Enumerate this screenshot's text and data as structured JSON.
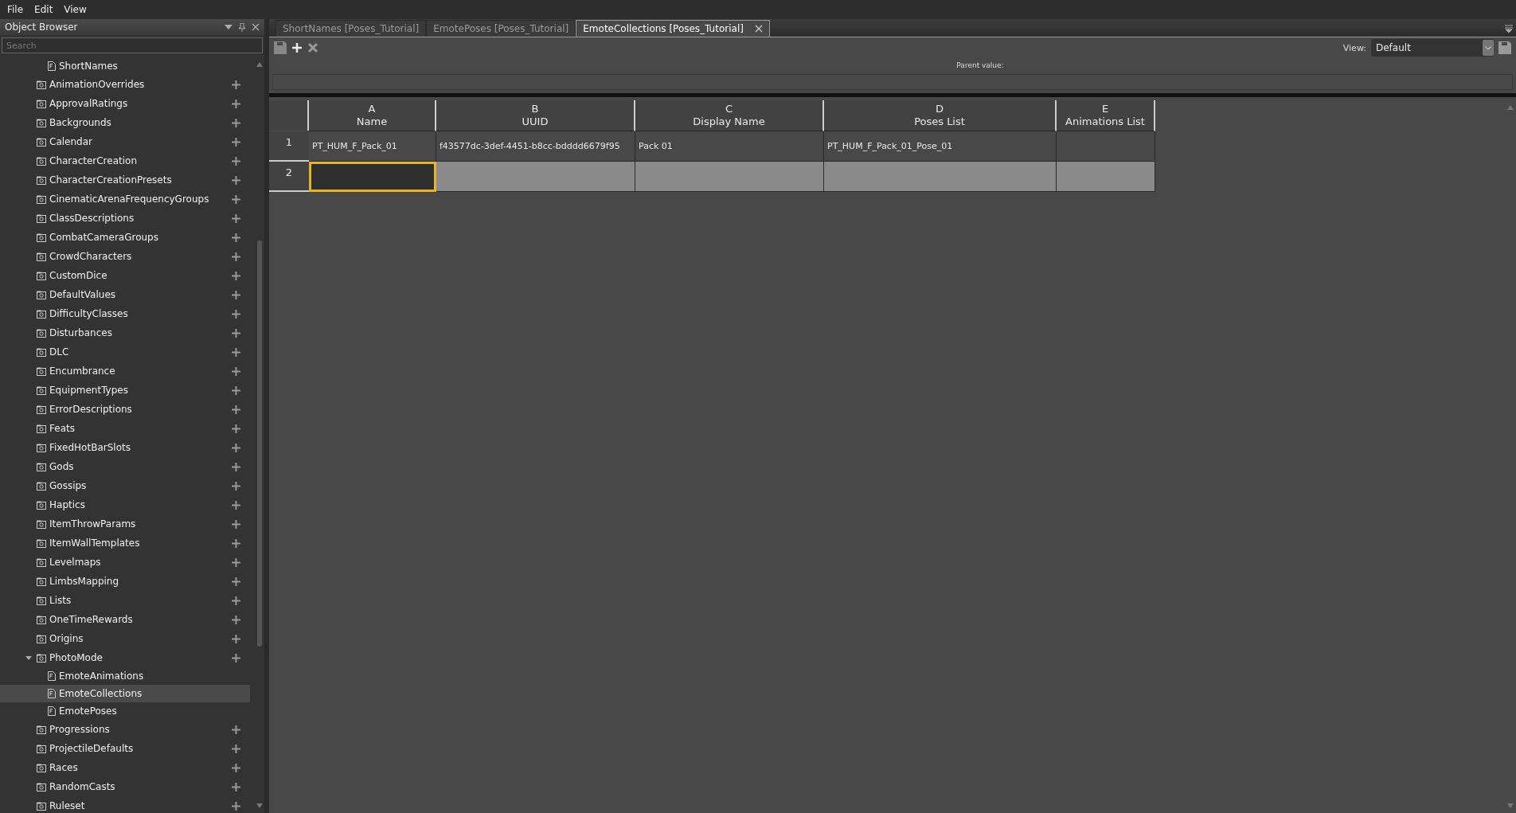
{
  "menu": [
    "File",
    "Edit",
    "View"
  ],
  "sidebar": {
    "title": "Object Browser",
    "search": {
      "placeholder": "Search"
    },
    "items": [
      {
        "label": "ShortNames",
        "kind": "file",
        "selected": false
      },
      {
        "label": "AnimationOverrides",
        "kind": "class"
      },
      {
        "label": "ApprovalRatings",
        "kind": "class"
      },
      {
        "label": "Backgrounds",
        "kind": "class"
      },
      {
        "label": "Calendar",
        "kind": "class"
      },
      {
        "label": "CharacterCreation",
        "kind": "class"
      },
      {
        "label": "CharacterCreationPresets",
        "kind": "class"
      },
      {
        "label": "CinematicArenaFrequencyGroups",
        "kind": "class"
      },
      {
        "label": "ClassDescriptions",
        "kind": "class"
      },
      {
        "label": "CombatCameraGroups",
        "kind": "class"
      },
      {
        "label": "CrowdCharacters",
        "kind": "class"
      },
      {
        "label": "CustomDice",
        "kind": "class"
      },
      {
        "label": "DefaultValues",
        "kind": "class"
      },
      {
        "label": "DifficultyClasses",
        "kind": "class"
      },
      {
        "label": "Disturbances",
        "kind": "class"
      },
      {
        "label": "DLC",
        "kind": "class"
      },
      {
        "label": "Encumbrance",
        "kind": "class"
      },
      {
        "label": "EquipmentTypes",
        "kind": "class"
      },
      {
        "label": "ErrorDescriptions",
        "kind": "class"
      },
      {
        "label": "Feats",
        "kind": "class"
      },
      {
        "label": "FixedHotBarSlots",
        "kind": "class"
      },
      {
        "label": "Gods",
        "kind": "class"
      },
      {
        "label": "Gossips",
        "kind": "class"
      },
      {
        "label": "Haptics",
        "kind": "class"
      },
      {
        "label": "ItemThrowParams",
        "kind": "class"
      },
      {
        "label": "ItemWallTemplates",
        "kind": "class"
      },
      {
        "label": "Levelmaps",
        "kind": "class"
      },
      {
        "label": "LimbsMapping",
        "kind": "class"
      },
      {
        "label": "Lists",
        "kind": "class"
      },
      {
        "label": "OneTimeRewards",
        "kind": "class"
      },
      {
        "label": "Origins",
        "kind": "class"
      },
      {
        "label": "PhotoMode",
        "kind": "class",
        "expanded": true,
        "children": [
          {
            "label": "EmoteAnimations",
            "kind": "file",
            "selected": false
          },
          {
            "label": "EmoteCollections",
            "kind": "file",
            "selected": true
          },
          {
            "label": "EmotePoses",
            "kind": "file",
            "selected": false
          }
        ]
      },
      {
        "label": "Progressions",
        "kind": "class"
      },
      {
        "label": "ProjectileDefaults",
        "kind": "class"
      },
      {
        "label": "Races",
        "kind": "class"
      },
      {
        "label": "RandomCasts",
        "kind": "class"
      },
      {
        "label": "Ruleset",
        "kind": "class"
      }
    ]
  },
  "tabs": [
    {
      "label": "ShortNames [Poses_Tutorial]",
      "selected": false
    },
    {
      "label": "EmotePoses [Poses_Tutorial]",
      "selected": false
    },
    {
      "label": "EmoteCollections [Poses_Tutorial]",
      "selected": true
    }
  ],
  "toolbar": {
    "parent_value_label": "Parent value:",
    "view_label": "View:",
    "view_value": "Default"
  },
  "table": {
    "columns": [
      {
        "letter": "A",
        "name": "Name"
      },
      {
        "letter": "B",
        "name": "UUID"
      },
      {
        "letter": "C",
        "name": "Display Name"
      },
      {
        "letter": "D",
        "name": "Poses List"
      },
      {
        "letter": "E",
        "name": "Animations List"
      }
    ],
    "rows": [
      {
        "number": "1",
        "selected": false,
        "cells": [
          "PT_HUM_F_Pack_01",
          "f43577dc-3def-4451-b8cc-bdddd6679f95",
          "Pack 01",
          "PT_HUM_F_Pack_01_Pose_01"
        ]
      },
      {
        "number": "2",
        "selected": true
      }
    ]
  }
}
